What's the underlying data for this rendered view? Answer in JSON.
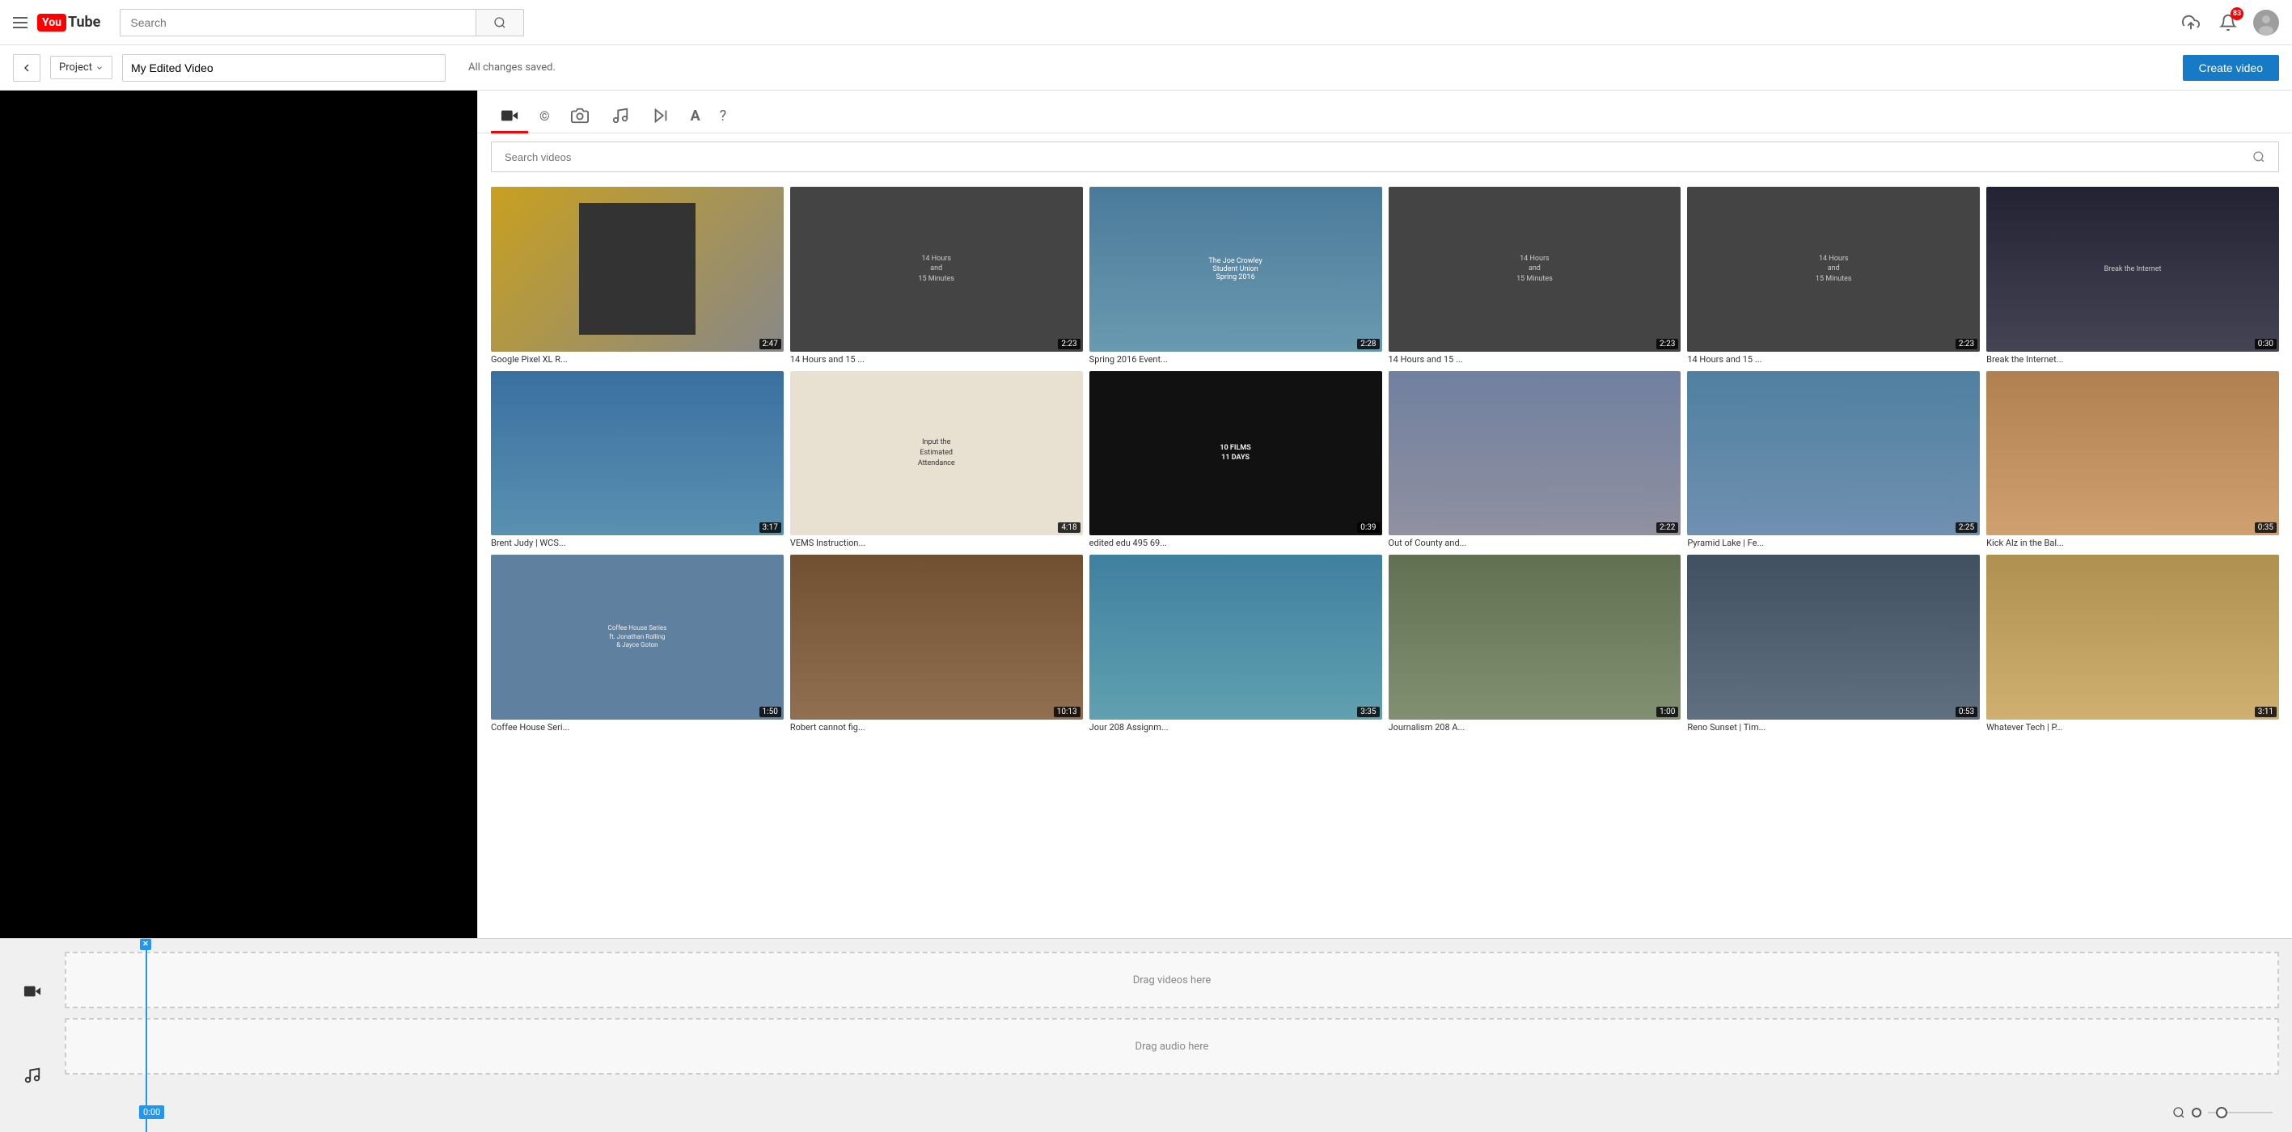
{
  "nav": {
    "search_placeholder": "Search",
    "notification_count": "83",
    "logo_box": "You",
    "logo_text": "Tube"
  },
  "toolbar": {
    "project_label": "Project",
    "title_value": "My Edited Video",
    "saved_status": "All changes saved.",
    "create_btn": "Create video"
  },
  "media_panel": {
    "search_placeholder": "Search videos",
    "tabs": [
      {
        "label": "🎥",
        "icon": "video-camera",
        "active": true
      },
      {
        "label": "©",
        "icon": "cc"
      },
      {
        "label": "📷",
        "icon": "photo"
      },
      {
        "label": "♪",
        "icon": "music"
      },
      {
        "label": "⏭",
        "icon": "transitions"
      },
      {
        "label": "A",
        "icon": "text"
      },
      {
        "label": "?",
        "icon": "help"
      }
    ],
    "videos": [
      {
        "title": "Google Pixel XL R...",
        "duration": "2:47",
        "bg": "#c8a020"
      },
      {
        "title": "14 Hours and 15 ...",
        "duration": "2:23",
        "bg": "#444"
      },
      {
        "title": "Spring 2016 Event...",
        "duration": "2:28",
        "bg": "#5080a0"
      },
      {
        "title": "14 Hours and 15 ...",
        "duration": "2:23",
        "bg": "#444"
      },
      {
        "title": "14 Hours and 15 ...",
        "duration": "2:23",
        "bg": "#444"
      },
      {
        "title": "Break the Internet...",
        "duration": "0:30",
        "bg": "#334"
      },
      {
        "title": "Brent Judy | WCS...",
        "duration": "3:17",
        "bg": "#4080a0"
      },
      {
        "title": "VEMS Instruction...",
        "duration": "4:18",
        "bg": "#ddd"
      },
      {
        "title": "edited edu 495 69...",
        "duration": "0:39",
        "bg": "#111"
      },
      {
        "title": "Out of County and...",
        "duration": "2:22",
        "bg": "#8090a0"
      },
      {
        "title": "Pyramid Lake | Fe...",
        "duration": "2:25",
        "bg": "#6090a0"
      },
      {
        "title": "Kick Alz in the Bal...",
        "duration": "0:35",
        "bg": "#c09060"
      },
      {
        "title": "Coffee House Seri...",
        "duration": "1:50",
        "bg": "#6080a0"
      },
      {
        "title": "Robert cannot fig...",
        "duration": "10:13",
        "bg": "#806040"
      },
      {
        "title": "Jour 208 Assignm...",
        "duration": "3:35",
        "bg": "#5090a0"
      },
      {
        "title": "Journalism 208 A...",
        "duration": "1:00",
        "bg": "#708060"
      },
      {
        "title": "Reno Sunset | Tim...",
        "duration": "0:53",
        "bg": "#506070"
      },
      {
        "title": "Whatever Tech | P...",
        "duration": "3:11",
        "bg": "#c0a060"
      }
    ]
  },
  "timeline": {
    "video_track_label": "Drag videos here",
    "audio_track_label": "Drag audio here",
    "time_marker": "0:00"
  },
  "video_thumbs": {
    "14hours_text": "14 Hours\nand\n15 Minutes",
    "vems_text": "Input the\nEstimated\nAttendance",
    "edited_text": "10 FILMS\n11 DAYS",
    "coffee_text": "Coffee House Series\nft. Jonathan Rolling\n& Jayce Goton"
  }
}
